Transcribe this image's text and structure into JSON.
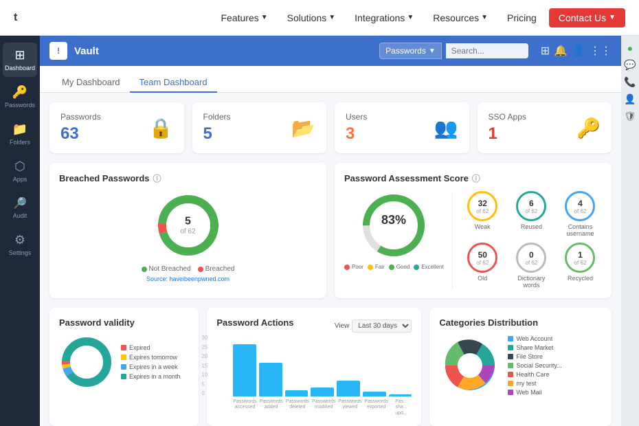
{
  "topnav": {
    "logo": "t",
    "links": [
      {
        "label": "Features",
        "has_dropdown": true
      },
      {
        "label": "Solutions",
        "has_dropdown": true
      },
      {
        "label": "Integrations",
        "has_dropdown": true
      },
      {
        "label": "Resources",
        "has_dropdown": true
      },
      {
        "label": "Pricing",
        "has_dropdown": false
      },
      {
        "label": "Contact Us",
        "has_dropdown": true,
        "is_button": true
      }
    ]
  },
  "sidebar": {
    "items": [
      {
        "label": "Dashboard",
        "icon": "⊞"
      },
      {
        "label": "Passwords",
        "icon": "🔑"
      },
      {
        "label": "Folders",
        "icon": "📁"
      },
      {
        "label": "Apps",
        "icon": "⬡"
      },
      {
        "label": "Audit",
        "icon": "🔍"
      },
      {
        "label": "Settings",
        "icon": "⚙"
      }
    ]
  },
  "vault": {
    "title": "Vault",
    "search_category": "Passwords",
    "search_placeholder": "Search...",
    "header_icons": [
      "⊞",
      "🔔",
      "⊞",
      "⋮⋮⋮"
    ]
  },
  "dashboard": {
    "tabs": [
      "My Dashboard",
      "Team Dashboard"
    ],
    "active_tab": "Team Dashboard",
    "stats": [
      {
        "label": "Passwords",
        "value": "63",
        "color": "blue"
      },
      {
        "label": "Folders",
        "value": "5",
        "color": "blue"
      },
      {
        "label": "Users",
        "value": "3",
        "color": "orange"
      },
      {
        "label": "SSO Apps",
        "value": "1",
        "color": "red"
      }
    ],
    "breached": {
      "title": "Breached Passwords",
      "not_breached": 57,
      "breached": 5,
      "total": 62,
      "center_num": "5",
      "center_sub": "of 62",
      "legend": [
        {
          "label": "Not Breached",
          "color": "#4caf50"
        },
        {
          "label": "Breached",
          "color": "#ef5350"
        }
      ],
      "source": "haveibeenpwned.com"
    },
    "assessment": {
      "title": "Password Assessment Score",
      "score": "83%",
      "legend": [
        "Poor",
        "Fair",
        "Good",
        "Excellent"
      ],
      "legend_colors": [
        "#ef5350",
        "#ffc107",
        "#4caf50",
        "#26a69a"
      ],
      "items": [
        {
          "num": "32",
          "of": "of 62",
          "label": "Weak",
          "color": "yellow"
        },
        {
          "num": "6",
          "of": "of 62",
          "label": "Reused",
          "color": "teal"
        },
        {
          "num": "4",
          "of": "of 62",
          "label": "Contains username",
          "color": "blue"
        },
        {
          "num": "50",
          "of": "of 62",
          "label": "Old",
          "color": "red-o"
        },
        {
          "num": "0",
          "of": "of 62",
          "label": "Dictionary words",
          "color": "gray"
        },
        {
          "num": "1",
          "of": "of 62",
          "label": "Recycled",
          "color": "green-c"
        }
      ]
    },
    "validity": {
      "title": "Password validity",
      "legend": [
        {
          "label": "Expired",
          "color": "#ef5350"
        },
        {
          "label": "Expires tomorrow",
          "color": "#ffc107"
        },
        {
          "label": "Expires in a week",
          "color": "#42a5f5"
        },
        {
          "label": "Expires in a month",
          "color": "#26a69a"
        }
      ]
    },
    "actions": {
      "title": "Password Actions",
      "view_label": "View",
      "period": "Last 30 days",
      "bars": [
        {
          "label": "Passwords\naccessed",
          "height": 85
        },
        {
          "label": "Passwords\nadded",
          "height": 60
        },
        {
          "label": "Passwords\ndeleted",
          "height": 10
        },
        {
          "label": "Passwords\nmodified",
          "height": 15
        },
        {
          "label": "Passwords\nviewed",
          "height": 25
        },
        {
          "label": "Passwords\nexported",
          "height": 8
        },
        {
          "label": "Pas...\nsha...\nupd...",
          "height": 3
        }
      ],
      "y_axis": [
        "30",
        "25",
        "20",
        "15",
        "10",
        "5",
        "0"
      ]
    },
    "categories": {
      "title": "Categories Distribution",
      "legend": [
        {
          "label": "Web Account",
          "color": "#42a5f5"
        },
        {
          "label": "Share Market",
          "color": "#26a69a"
        },
        {
          "label": "File Store",
          "color": "#37474f"
        },
        {
          "label": "Social Security...",
          "color": "#66bb6a"
        },
        {
          "label": "Health Care",
          "color": "#ef5350"
        },
        {
          "label": "my test",
          "color": "#ffa726"
        },
        {
          "label": "Web Mail",
          "color": "#ab47bc"
        }
      ]
    }
  },
  "right_sidebar": {
    "icons": [
      "●",
      "💬",
      "📞",
      "👤",
      "🛡"
    ]
  }
}
